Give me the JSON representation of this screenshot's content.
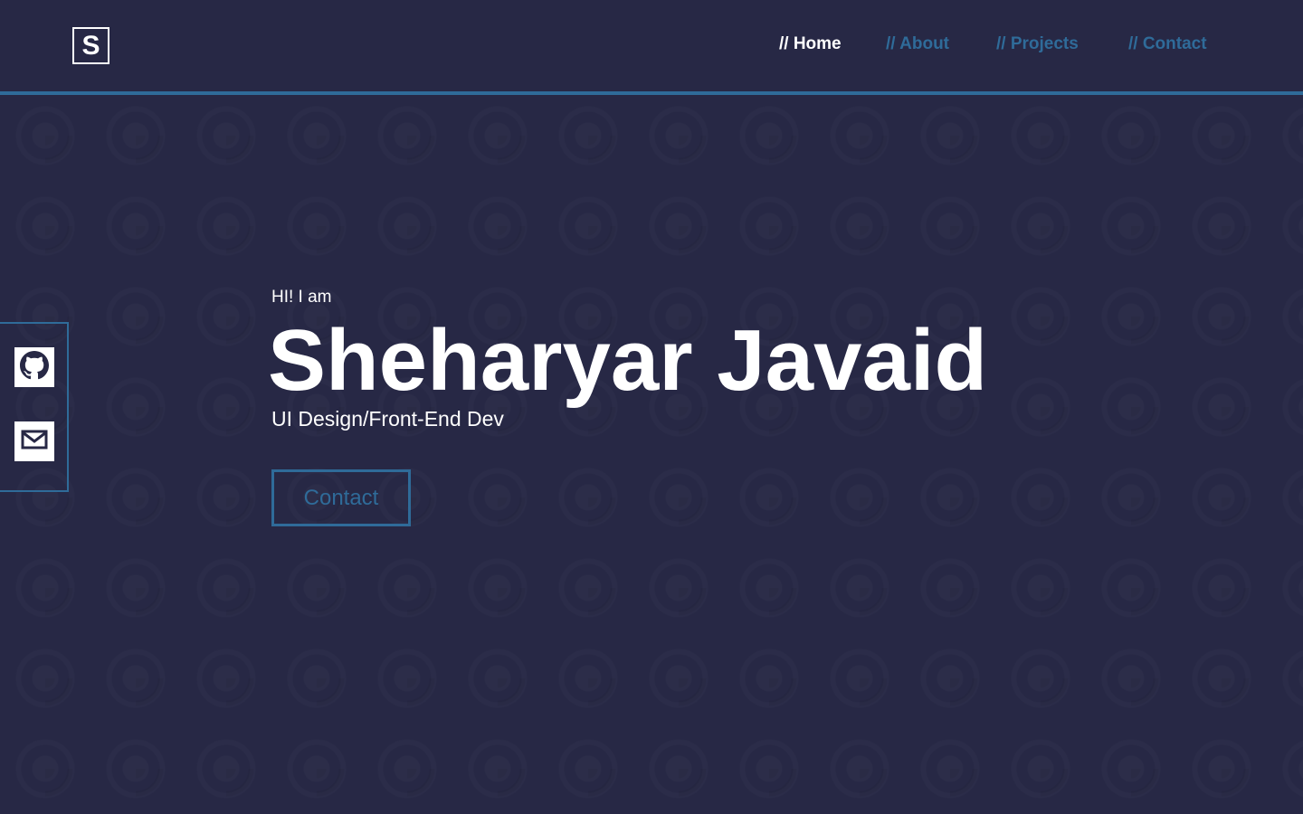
{
  "brand": {
    "logo_letter": "S"
  },
  "nav": {
    "items": [
      {
        "label": "// Home",
        "active": true
      },
      {
        "label": "// About",
        "active": false
      },
      {
        "label": "// Projects",
        "active": false
      },
      {
        "label": "// Contact",
        "active": false
      }
    ]
  },
  "social": {
    "links": [
      {
        "icon": "github-icon"
      },
      {
        "icon": "mail-icon"
      }
    ]
  },
  "hero": {
    "greeting": "HI! I am",
    "name": "Sheharyar Javaid",
    "role": "UI Design/Front-End Dev",
    "cta_label": "Contact"
  },
  "colors": {
    "background": "#272845",
    "accent": "#2f6b99",
    "text": "#ffffff"
  }
}
